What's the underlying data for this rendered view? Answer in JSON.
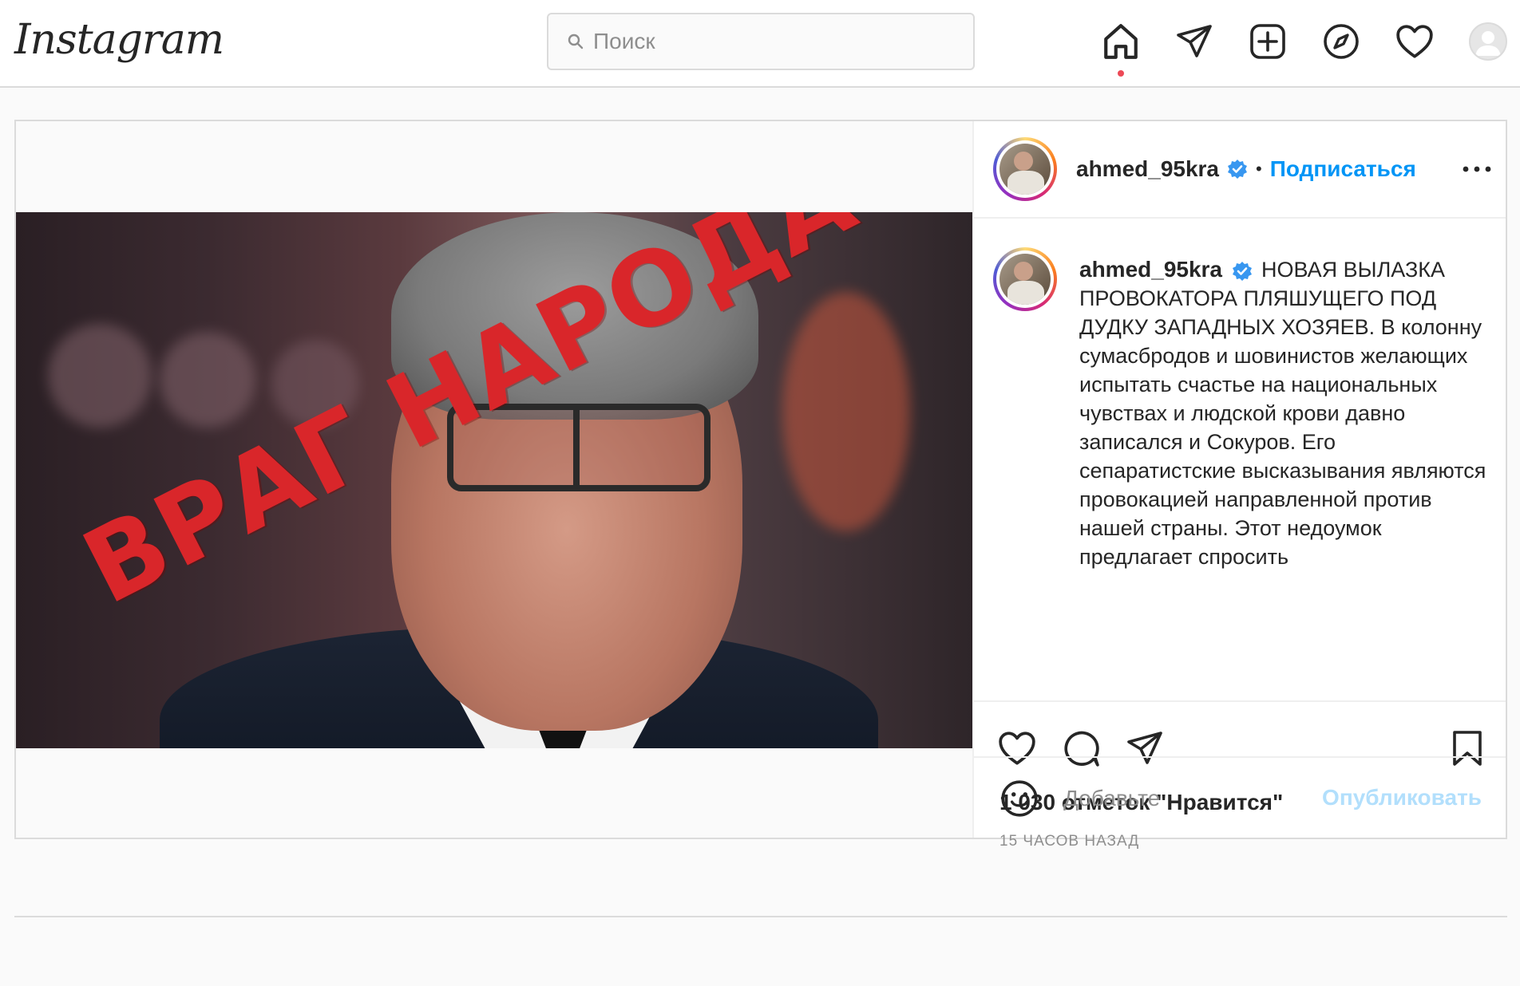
{
  "header": {
    "logo": "Instagram",
    "search_placeholder": "Поиск",
    "icons": [
      "home-icon",
      "direct-icon",
      "new-post-icon",
      "explore-icon",
      "activity-heart-icon",
      "profile-avatar"
    ],
    "notification_dot_color": "#ed4956"
  },
  "post": {
    "image_stamp_text": "ВРАГ НАРОДА",
    "username": "ahmed_95kra",
    "separator": "•",
    "follow_label": "Подписаться",
    "more_icon": "ellipsis-icon",
    "caption": "НОВАЯ ВЫЛАЗКА ПРОВОКАТОРА ПЛЯШУЩЕГО ПОД ДУДКУ ЗАПАДНЫХ ХОЗЯЕВ. В колонну сумасбродов и шовинистов желающих испытать счастье на национальных чувствах и людской крови давно записался и Сокуров. Его сепаратистские высказывания являются провокацией направленной против нашей страны. Этот недоумок предлагает спросить",
    "likes": "1 030 отметок \"Нравится\"",
    "time_ago": "15 ЧАСОВ НАЗАД",
    "comment_placeholder": "Добавьте",
    "publish_label": "Опубликовать",
    "accent_color": "#0095f6",
    "verified_color": "#3897f0"
  }
}
